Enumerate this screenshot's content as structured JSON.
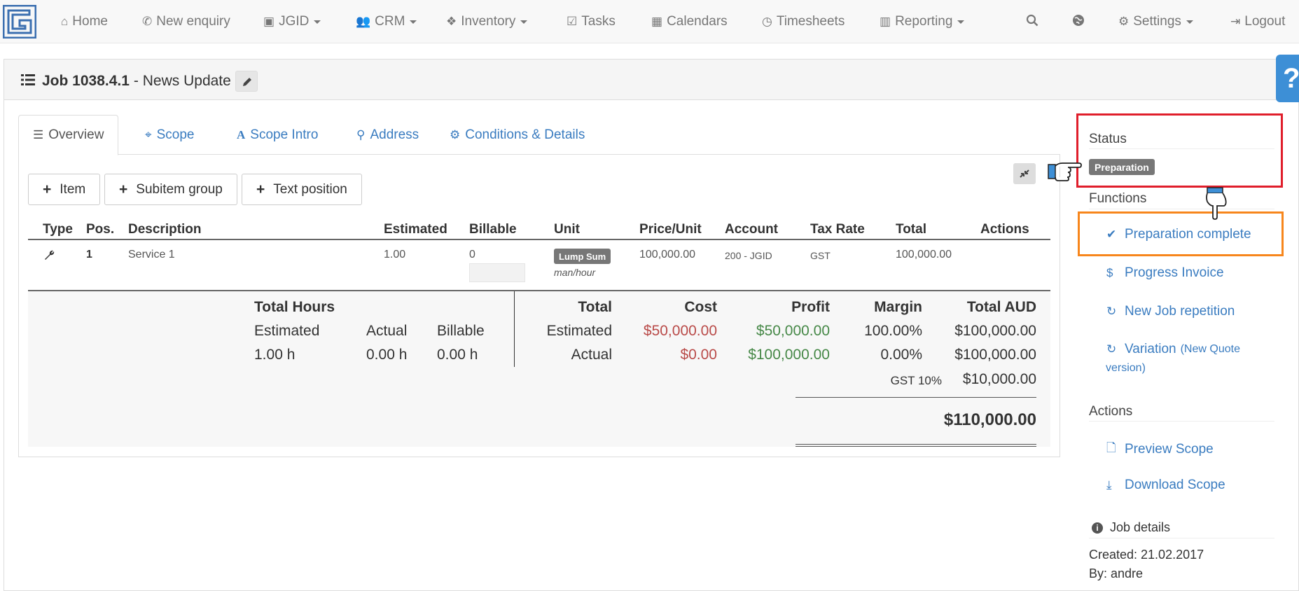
{
  "nav": {
    "home": "Home",
    "new_enquiry": "New enquiry",
    "jgid": "JGID",
    "crm": "CRM",
    "inventory": "Inventory",
    "tasks": "Tasks",
    "calendars": "Calendars",
    "timesheets": "Timesheets",
    "reporting": "Reporting",
    "settings": "Settings",
    "logout": "Logout"
  },
  "page": {
    "job_number": "Job 1038.4.1",
    "job_name": "- News Update",
    "help": "?"
  },
  "tabs": [
    "Overview",
    "Scope",
    "Scope Intro",
    "Address",
    "Conditions & Details"
  ],
  "buttons": {
    "item": "Item",
    "subitem_group": "Subitem group",
    "text_position": "Text position"
  },
  "table": {
    "headers": [
      "Type",
      "Pos.",
      "Description",
      "Estimated",
      "Billable",
      "Unit",
      "Price/Unit",
      "Account",
      "Tax Rate",
      "Total",
      "Actions"
    ],
    "rows": [
      {
        "pos": "1",
        "description": "Service 1",
        "estimated": "1.00",
        "billable": "0",
        "unit_badge": "Lump Sum",
        "unit_sub": "man/hour",
        "price_unit": "100,000.00",
        "account": "200 - JGID",
        "tax_rate": "GST",
        "total": "100,000.00"
      }
    ]
  },
  "totals": {
    "hours_title": "Total Hours",
    "hours_labels": [
      "Estimated",
      "Actual",
      "Billable"
    ],
    "hours_values": [
      "1.00 h",
      "0.00 h",
      "0.00 h"
    ],
    "headers": [
      "Total",
      "Cost",
      "Profit",
      "Margin",
      "Total AUD"
    ],
    "estimated": {
      "label": "Estimated",
      "cost": "$50,000.00",
      "profit": "$50,000.00",
      "margin": "100.00%",
      "total": "$100,000.00"
    },
    "actual": {
      "label": "Actual",
      "cost": "$0.00",
      "profit": "$100,000.00",
      "margin": "0.00%",
      "total": "$100,000.00"
    },
    "gst_label": "GST 10%",
    "gst_value": "$10,000.00",
    "grand_total": "$110,000.00"
  },
  "sidebar": {
    "status_title": "Status",
    "status_value": "Preparation",
    "functions_title": "Functions",
    "preparation_complete": "Preparation complete",
    "progress_invoice": "Progress Invoice",
    "new_job_repetition": "New Job repetition",
    "variation": "Variation",
    "variation_sub_1": "(New Quote",
    "variation_sub_2": "version)",
    "actions_title": "Actions",
    "preview_scope": "Preview Scope",
    "download_scope": "Download Scope",
    "job_details_title": "Job details",
    "created": "Created: 21.02.2017",
    "by": "By: andre"
  },
  "colors": {
    "link": "#3a7cc0",
    "highlight_red": "#e01e2b",
    "highlight_orange": "#f7861c",
    "cost": "#b94a48",
    "profit": "#468847"
  }
}
